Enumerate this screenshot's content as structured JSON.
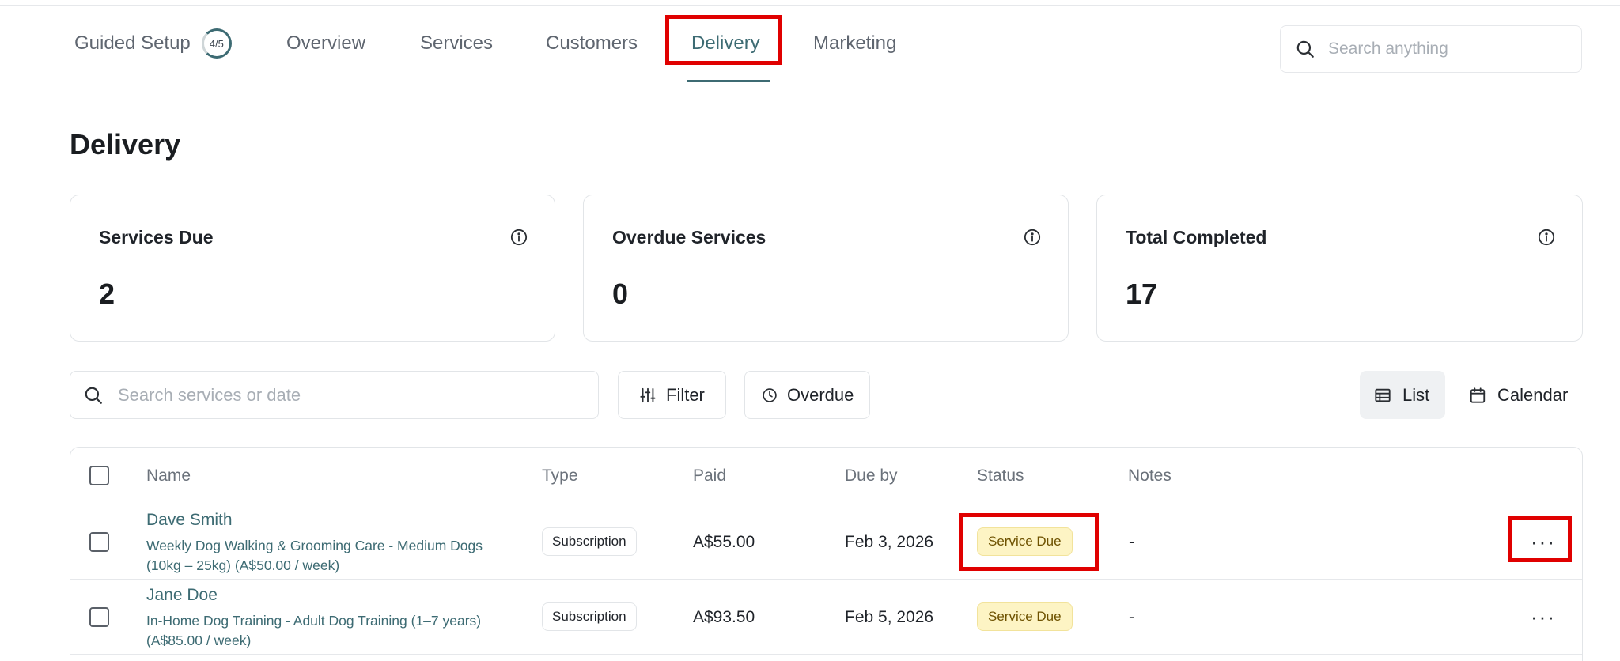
{
  "nav": {
    "guided_setup": "Guided Setup",
    "guided_progress": "4/5",
    "tabs": [
      "Overview",
      "Services",
      "Customers",
      "Delivery",
      "Marketing"
    ],
    "active_tab": "Delivery",
    "search_placeholder": "Search anything"
  },
  "page": {
    "title": "Delivery"
  },
  "stats": [
    {
      "label": "Services Due",
      "value": "2"
    },
    {
      "label": "Overdue Services",
      "value": "0"
    },
    {
      "label": "Total Completed",
      "value": "17"
    }
  ],
  "toolbar": {
    "search_placeholder": "Search services or date",
    "filter_label": "Filter",
    "overdue_label": "Overdue",
    "list_label": "List",
    "calendar_label": "Calendar",
    "selected_view": "List"
  },
  "table": {
    "columns": [
      "Name",
      "Type",
      "Paid",
      "Due by",
      "Status",
      "Notes"
    ],
    "rows": [
      {
        "name": "Dave Smith",
        "service": "Weekly Dog Walking & Grooming Care - Medium Dogs (10kg – 25kg) (A$50.00 / week)",
        "type": "Subscription",
        "paid": "A$55.00",
        "due_by": "Feb 3, 2026",
        "status": "Service Due",
        "notes": "-"
      },
      {
        "name": "Jane Doe",
        "service": "In-Home Dog Training - Adult Dog Training (1–7 years) (A$85.00 / week)",
        "type": "Subscription",
        "paid": "A$93.50",
        "due_by": "Feb 5, 2026",
        "status": "Service Due",
        "notes": "-"
      }
    ]
  },
  "colors": {
    "accent": "#3d6b73",
    "highlight_box": "#e00000",
    "status_due_bg": "#fdf4c4",
    "status_due_text": "#6e5200"
  },
  "icons": [
    "search-icon",
    "info-icon",
    "sliders-icon",
    "clock-icon",
    "table-list-icon",
    "calendar-icon",
    "more-horizontal-icon"
  ]
}
